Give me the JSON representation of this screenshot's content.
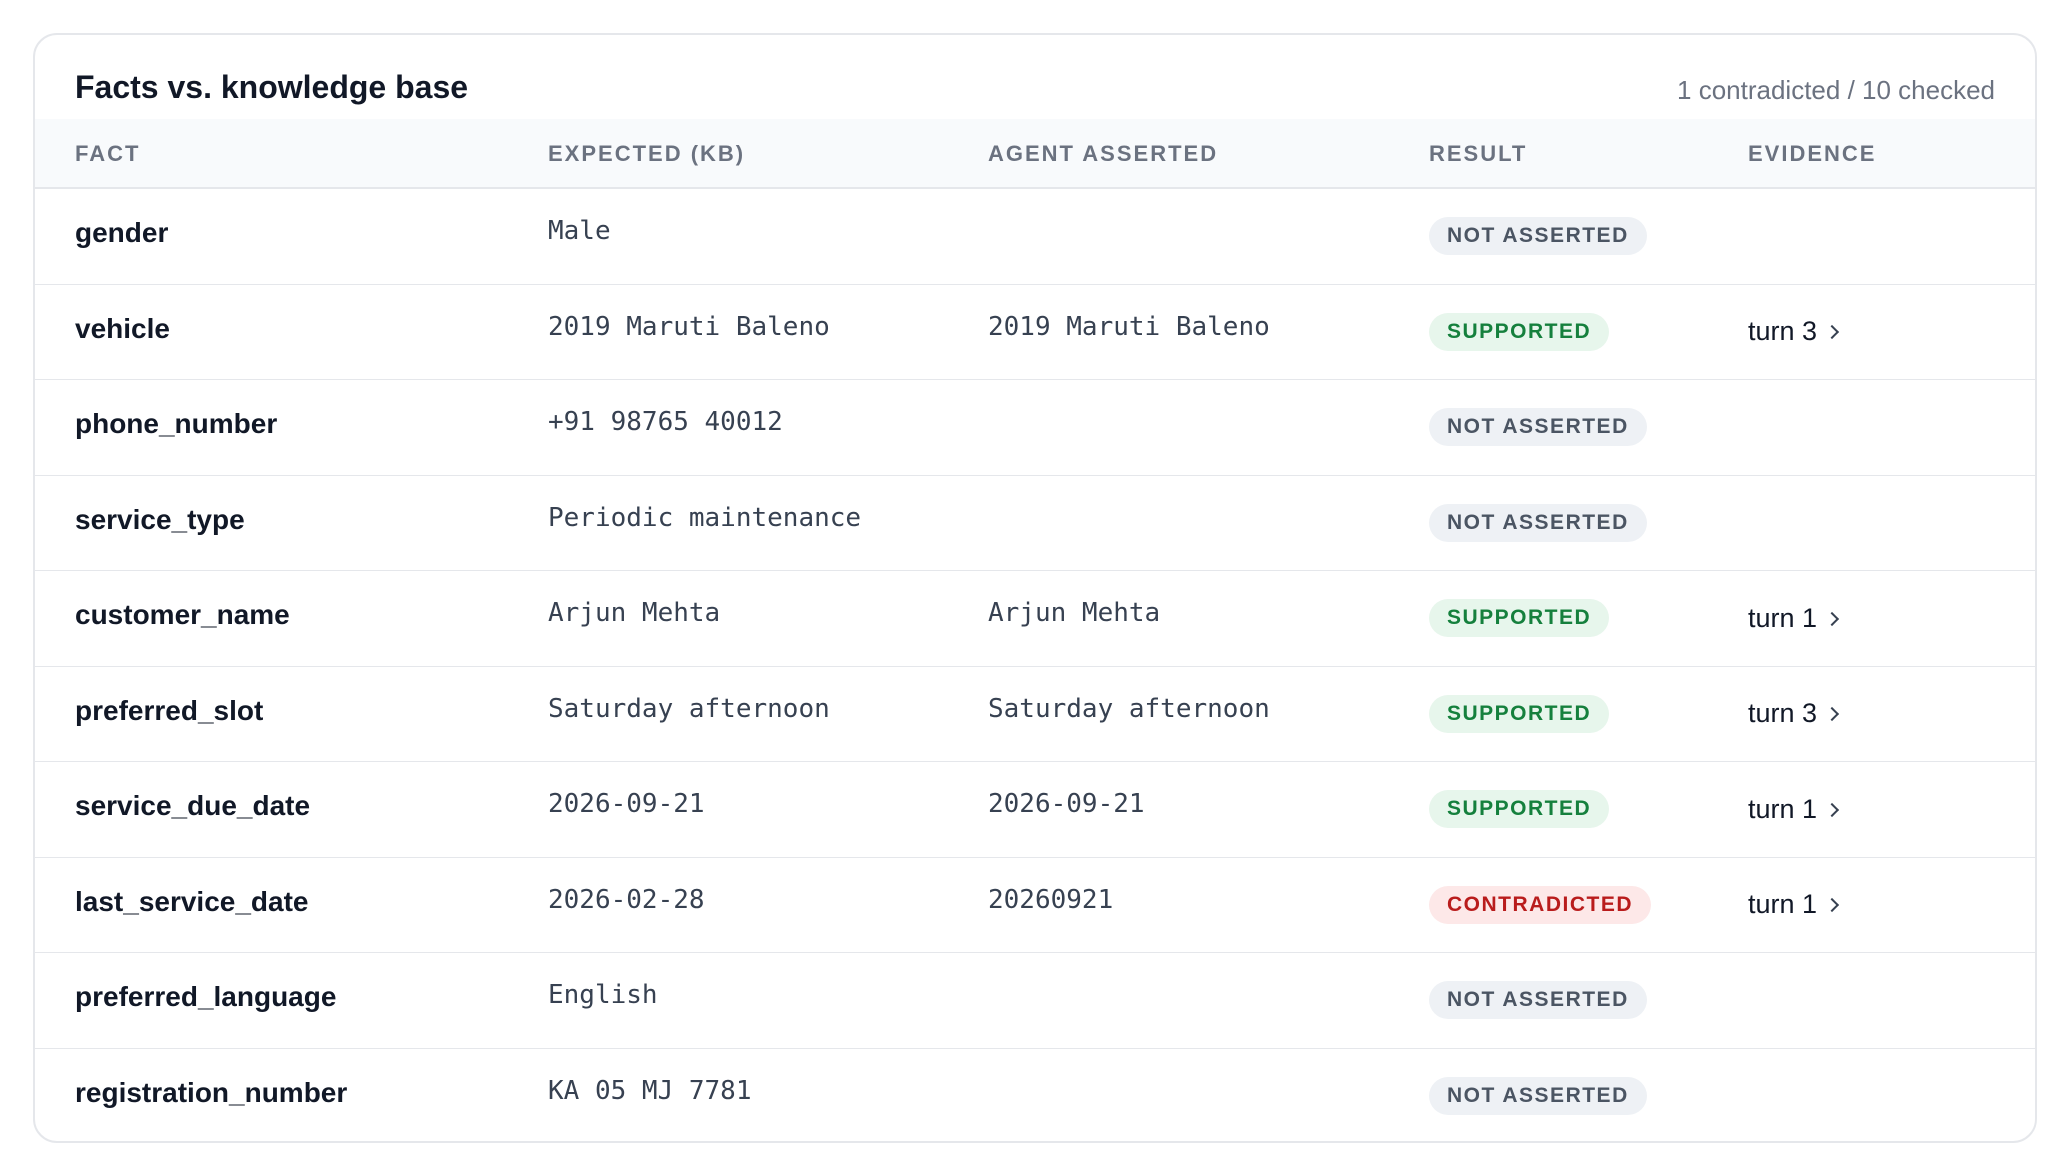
{
  "card": {
    "title": "Facts vs. knowledge base",
    "summary": "1 contradicted / 10 checked"
  },
  "columns": {
    "fact": "FACT",
    "expected": "EXPECTED (KB)",
    "agent": "AGENT ASSERTED",
    "result": "RESULT",
    "evidence": "EVIDENCE"
  },
  "rows": [
    {
      "fact": "gender",
      "expected": "Male",
      "agent": "",
      "result": "NOT ASSERTED",
      "status": "not-asserted",
      "evidence": ""
    },
    {
      "fact": "vehicle",
      "expected": "2019 Maruti Baleno",
      "agent": "2019 Maruti Baleno",
      "result": "SUPPORTED",
      "status": "supported",
      "evidence": "turn 3"
    },
    {
      "fact": "phone_number",
      "expected": "+91 98765 40012",
      "agent": "",
      "result": "NOT ASSERTED",
      "status": "not-asserted",
      "evidence": ""
    },
    {
      "fact": "service_type",
      "expected": "Periodic maintenance",
      "agent": "",
      "result": "NOT ASSERTED",
      "status": "not-asserted",
      "evidence": ""
    },
    {
      "fact": "customer_name",
      "expected": "Arjun Mehta",
      "agent": "Arjun Mehta",
      "result": "SUPPORTED",
      "status": "supported",
      "evidence": "turn 1"
    },
    {
      "fact": "preferred_slot",
      "expected": "Saturday afternoon",
      "agent": "Saturday afternoon",
      "result": "SUPPORTED",
      "status": "supported",
      "evidence": "turn 3"
    },
    {
      "fact": "service_due_date",
      "expected": "2026-09-21",
      "agent": "2026-09-21",
      "result": "SUPPORTED",
      "status": "supported",
      "evidence": "turn 1"
    },
    {
      "fact": "last_service_date",
      "expected": "2026-02-28",
      "agent": "20260921",
      "result": "CONTRADICTED",
      "status": "contradicted",
      "evidence": "turn 1"
    },
    {
      "fact": "preferred_language",
      "expected": "English",
      "agent": "",
      "result": "NOT ASSERTED",
      "status": "not-asserted",
      "evidence": ""
    },
    {
      "fact": "registration_number",
      "expected": "KA 05 MJ 7781",
      "agent": "",
      "result": "NOT ASSERTED",
      "status": "not-asserted",
      "evidence": ""
    }
  ],
  "colors": {
    "supported": "#15803d",
    "contradicted": "#b91c1c",
    "not_asserted": "#4b5563"
  }
}
